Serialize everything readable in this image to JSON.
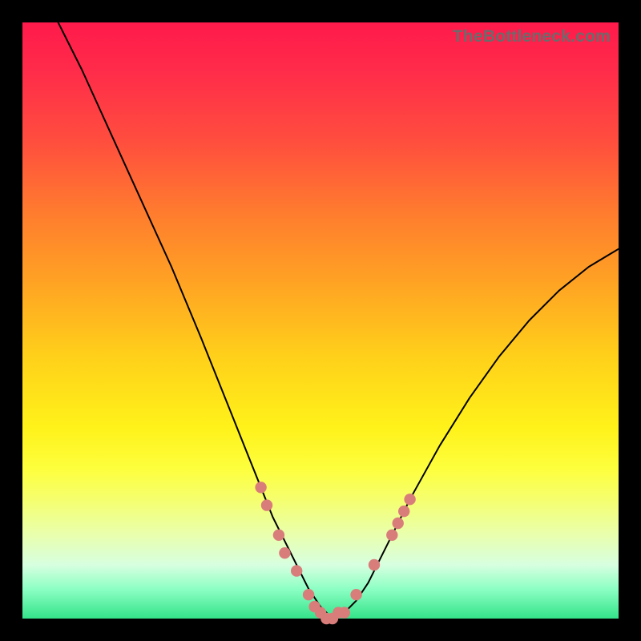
{
  "watermark": "TheBottleneck.com",
  "chart_data": {
    "type": "line",
    "title": "",
    "xlabel": "",
    "ylabel": "",
    "xlim": [
      0,
      100
    ],
    "ylim": [
      0,
      100
    ],
    "note": "V-shaped bottleneck curve over rainbow gradient. y≈100 is red (bad), y≈0 is green (good). Minimum near x≈51.",
    "series": [
      {
        "name": "bottleneck-curve",
        "x": [
          6,
          10,
          15,
          20,
          25,
          30,
          34,
          38,
          40,
          42,
          44,
          46,
          48,
          50,
          52,
          54,
          56,
          58,
          60,
          62,
          65,
          70,
          75,
          80,
          85,
          90,
          95,
          100
        ],
        "y": [
          100,
          92,
          81,
          70,
          59,
          47,
          37,
          27,
          22,
          17,
          13,
          9,
          5,
          2,
          0,
          1,
          3,
          6,
          10,
          14,
          20,
          29,
          37,
          44,
          50,
          55,
          59,
          62
        ]
      }
    ],
    "markers": {
      "name": "highlight-dots",
      "color": "#d97d7a",
      "points": [
        {
          "x": 40,
          "y": 22
        },
        {
          "x": 41,
          "y": 19
        },
        {
          "x": 43,
          "y": 14
        },
        {
          "x": 44,
          "y": 11
        },
        {
          "x": 46,
          "y": 8
        },
        {
          "x": 48,
          "y": 4
        },
        {
          "x": 49,
          "y": 2
        },
        {
          "x": 50,
          "y": 1
        },
        {
          "x": 51,
          "y": 0
        },
        {
          "x": 52,
          "y": 0
        },
        {
          "x": 53,
          "y": 1
        },
        {
          "x": 54,
          "y": 1
        },
        {
          "x": 56,
          "y": 4
        },
        {
          "x": 59,
          "y": 9
        },
        {
          "x": 62,
          "y": 14
        },
        {
          "x": 63,
          "y": 16
        },
        {
          "x": 64,
          "y": 18
        },
        {
          "x": 65,
          "y": 20
        }
      ]
    }
  }
}
